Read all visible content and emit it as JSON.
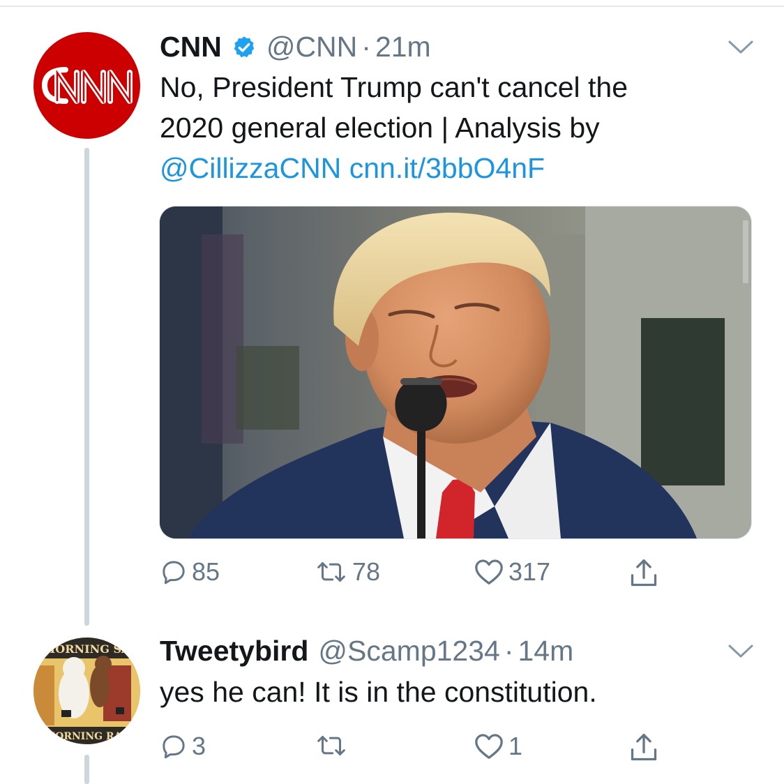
{
  "tweets": [
    {
      "name": "CNN",
      "handle": "@CNN",
      "time": "21m",
      "verified": true,
      "avatar_logo_text": "CNN",
      "text_line1": "No, President Trump can't cancel the",
      "text_line2": "2020 general election | Analysis by",
      "mention": "@CillizzaCNN",
      "link": "cnn.it/3bbO4nF",
      "replies": "85",
      "retweets": "78",
      "likes": "317"
    },
    {
      "name": "Tweetybird",
      "handle": "@Scamp1234",
      "time": "14m",
      "verified": false,
      "avatar_banner_top": "MORNING SA",
      "avatar_banner_bottom": "MORNING RAL",
      "text": "yes he can! It is in the constitution.",
      "replies": "3",
      "retweets": "",
      "likes": "1"
    }
  ],
  "separator": "·",
  "colors": {
    "link": "#1b95e0",
    "muted": "#657786",
    "thread_line": "#ccd6dd",
    "cnn_red": "#cc0000"
  },
  "icons": {
    "reply": "reply-icon",
    "retweet": "retweet-icon",
    "like": "heart-icon",
    "share": "share-icon",
    "more": "chevron-down-icon",
    "verified": "verified-badge-icon"
  }
}
